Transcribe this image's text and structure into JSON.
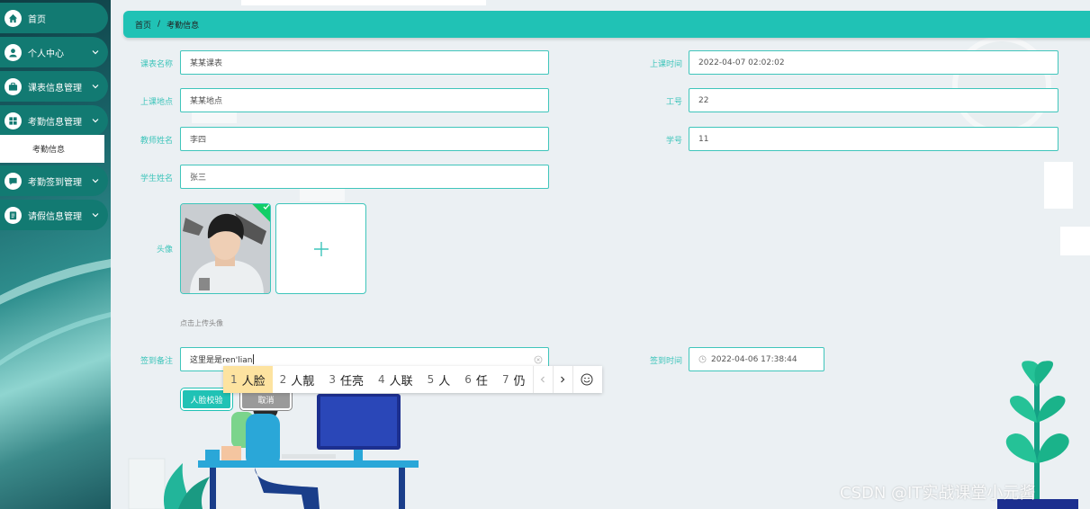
{
  "sidebar": {
    "items": [
      {
        "label": "首页",
        "icon": "home-icon"
      },
      {
        "label": "个人中心",
        "icon": "user-icon"
      },
      {
        "label": "课表信息管理",
        "icon": "briefcase-icon"
      },
      {
        "label": "考勤信息管理",
        "icon": "grid-icon"
      },
      {
        "label": "考勤签到管理",
        "icon": "chat-icon"
      },
      {
        "label": "请假信息管理",
        "icon": "clipboard-icon"
      }
    ],
    "submenu": {
      "label": "考勤信息"
    }
  },
  "breadcrumb": {
    "home": "首页",
    "separator": "/",
    "current": "考勤信息"
  },
  "form": {
    "course_table": {
      "label": "课表名称",
      "value": "某某课表"
    },
    "class_time": {
      "label": "上课时间",
      "value": "2022-04-07 02:02:02"
    },
    "location": {
      "label": "上课地点",
      "value": "某某地点"
    },
    "staff_no": {
      "label": "工号",
      "value": "22"
    },
    "teacher_name": {
      "label": "教师姓名",
      "value": "李四"
    },
    "student_no": {
      "label": "学号",
      "value": "11"
    },
    "student_name": {
      "label": "学生姓名",
      "value": "张三"
    },
    "avatar": {
      "label": "头像",
      "hint": "点击上传头像"
    },
    "remark": {
      "label": "签到备注",
      "value": "这里是是ren'lian"
    },
    "checkin_time": {
      "label": "签到时间",
      "value": "2022-04-06 17:38:44"
    }
  },
  "buttons": {
    "face_verify": "人脸校验",
    "cancel": "取消"
  },
  "ime": {
    "candidates": [
      {
        "num": "1",
        "text": "人脸"
      },
      {
        "num": "2",
        "text": "人靓"
      },
      {
        "num": "3",
        "text": "任亮"
      },
      {
        "num": "4",
        "text": "人联"
      },
      {
        "num": "5",
        "text": "人"
      },
      {
        "num": "6",
        "text": "任"
      },
      {
        "num": "7",
        "text": "仍"
      }
    ]
  },
  "watermark": "CSDN @IT实战课堂小元酱",
  "colors": {
    "accent": "#20c2b5",
    "sidebar_item": "#127a72",
    "label": "#3fc5bb",
    "success": "#13ce66"
  }
}
